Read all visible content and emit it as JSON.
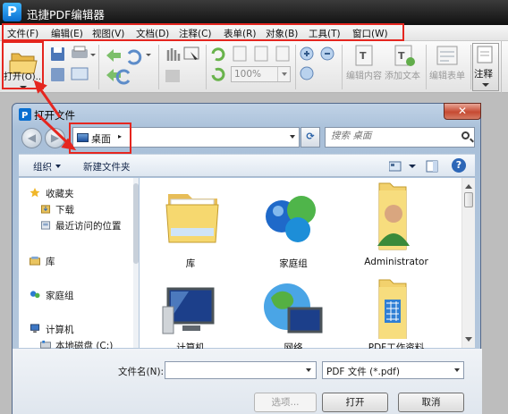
{
  "app": {
    "logo_letter": "P",
    "title": "迅捷PDF编辑器"
  },
  "menubar": {
    "items": [
      "文件(F)",
      "编辑(E)",
      "视图(V)",
      "文档(D)",
      "注释(C)",
      "表单(R)",
      "对象(B)",
      "工具(T)",
      "窗口(W)"
    ]
  },
  "toolbar": {
    "open_label": "打开(O)...",
    "zoom_value": "100%",
    "edit_content_label": "编辑内容",
    "add_text_label": "添加文本",
    "edit_form_label": "编辑表单",
    "annotate_label": "注释"
  },
  "dialog": {
    "title": "打开文件",
    "close_glyph": "✕",
    "back_glyph": "◀",
    "forward_glyph": "▶",
    "breadcrumb": "桌面",
    "breadcrumb_separator": "▸",
    "refresh_glyph": "⟳",
    "search_placeholder": "搜索 桌面",
    "organize_label": "组织",
    "new_folder_label": "新建文件夹",
    "help_glyph": "?",
    "nav": {
      "favorites": "收藏夹",
      "downloads": "下载",
      "recent": "最近访问的位置",
      "libraries": "库",
      "homegroup": "家庭组",
      "computer": "计算机",
      "local_disk": "本地磁盘 (C:)"
    },
    "files": [
      "库",
      "家庭组",
      "Administrator",
      "计算机",
      "网络",
      "PDF工作资料"
    ],
    "filename_label": "文件名(N):",
    "filename_value": "",
    "filetype_value": "PDF 文件 (*.pdf)",
    "options_label": "选项...",
    "open_button": "打开",
    "cancel_button": "取消"
  },
  "colors": {
    "highlight_box": "#e5261f",
    "accent": "#0a6fd0"
  }
}
